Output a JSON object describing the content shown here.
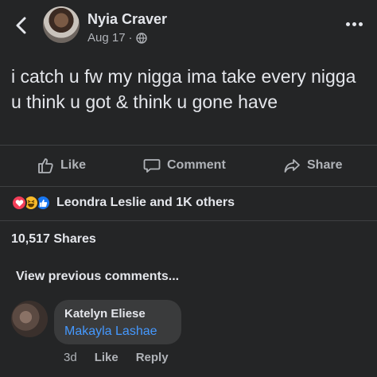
{
  "header": {
    "author_name": "Nyia Craver",
    "date": "Aug 17",
    "separator": "·",
    "back_icon": "chevron-left-icon",
    "privacy_icon": "globe-icon",
    "more_icon": "more-horizontal-icon"
  },
  "post": {
    "text": "i catch u fw my nigga ima take every nigga u think u got & think u gone have"
  },
  "actions": {
    "like_label": "Like",
    "comment_label": "Comment",
    "share_label": "Share"
  },
  "reactions": {
    "icons": [
      "love",
      "haha",
      "like"
    ],
    "summary": "Leondra Leslie and 1K others"
  },
  "shares": {
    "text": "10,517 Shares"
  },
  "comments": {
    "view_previous_label": "View previous comments...",
    "items": [
      {
        "author": "Katelyn Eliese",
        "text": "Makayla Lashae",
        "time": "3d",
        "like_label": "Like",
        "reply_label": "Reply"
      }
    ]
  },
  "colors": {
    "background": "#242526",
    "text_primary": "#e4e6eb",
    "text_secondary": "#b0b3b8",
    "mention_blue": "#4599ff",
    "bubble": "#3a3b3c",
    "love_red": "#f33e58",
    "haha_yellow": "#f7b928",
    "like_blue": "#1877f2"
  }
}
